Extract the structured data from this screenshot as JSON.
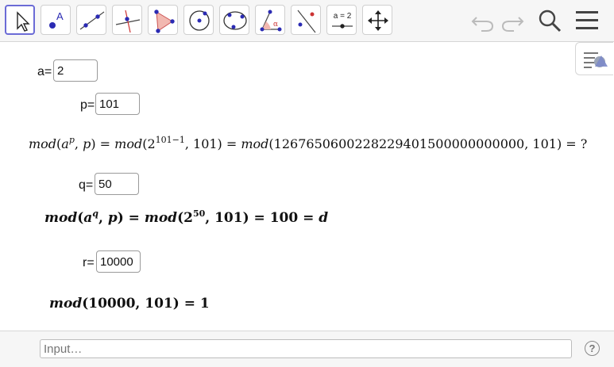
{
  "toolbar": {
    "tools": [
      {
        "name": "move-tool",
        "active": true
      },
      {
        "name": "point-tool",
        "label": "A"
      },
      {
        "name": "line-tool"
      },
      {
        "name": "perpendicular-line-tool"
      },
      {
        "name": "polygon-tool"
      },
      {
        "name": "circle-center-point-tool"
      },
      {
        "name": "circle-three-points-tool"
      },
      {
        "name": "angle-tool",
        "label": "α"
      },
      {
        "name": "reflect-tool"
      },
      {
        "name": "slider-tool",
        "label": "a = 2"
      },
      {
        "name": "move-graphics-view-tool"
      }
    ],
    "right_icons": [
      "undo-icon",
      "redo-icon",
      "search-icon",
      "menu-icon"
    ]
  },
  "fields": {
    "a": {
      "label": "a=",
      "value": "2"
    },
    "p": {
      "label": "p=",
      "value": "101"
    },
    "q": {
      "label": "q=",
      "value": "50"
    },
    "r": {
      "label": "r=",
      "value": "10000"
    }
  },
  "formulas": {
    "line1": {
      "mod": "mod",
      "a": "a",
      "p_exp": "p",
      "p": "p",
      "eq1": ") = ",
      "mod2": "mod",
      "base2": "2",
      "exp2": "101−1",
      "mid2": ", 101) = ",
      "mod3": "mod",
      "big": "(1267650600228229401500000000000, 101) = ?"
    },
    "line2": {
      "mod": "mod",
      "a": "a",
      "q_exp": "q",
      "p": "p",
      "eq": ") = ",
      "mod2": "mod",
      "base": "(2",
      "exp": "50",
      "rest": ", 101) = 100 = ",
      "d": "d"
    },
    "line3": {
      "mod": "mod",
      "rest": "(10000, 101) = 1"
    }
  },
  "input_bar": {
    "placeholder": "Input…"
  },
  "help_icon": "?"
}
